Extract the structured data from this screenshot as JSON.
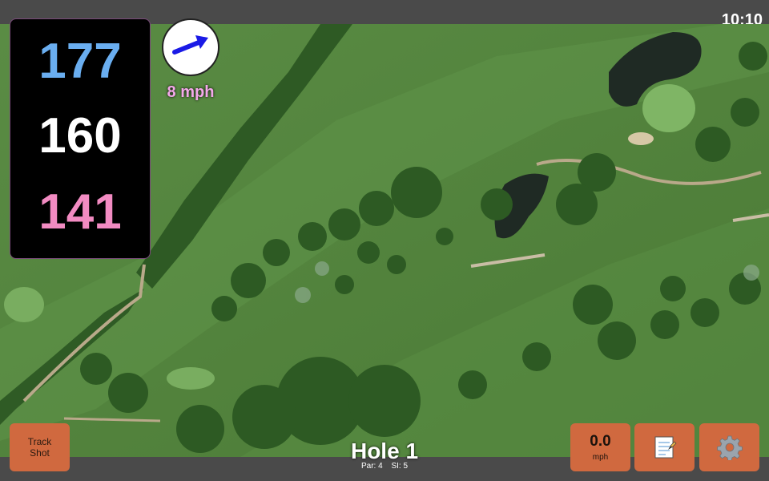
{
  "status_bar": {
    "time": "10:10"
  },
  "distances": {
    "back": "177",
    "middle": "160",
    "front": "141"
  },
  "wind": {
    "speed": "8 mph"
  },
  "track_shot": {
    "label": "Track\nShot"
  },
  "hole": {
    "title": "Hole 1",
    "par": "Par: 4",
    "si": "SI: 5"
  },
  "wind_button": {
    "value": "0.0",
    "unit": "mph"
  },
  "icons": {
    "wind_arrow": "wind-direction-arrow",
    "notes": "scorecard-notes-icon",
    "settings": "gear-icon"
  },
  "colors": {
    "back_distance": "#6aaef0",
    "middle_distance": "#ffffff",
    "front_distance": "#f28bc2",
    "button": "#d0693f",
    "wind_arrow": "#1a1ae6"
  }
}
